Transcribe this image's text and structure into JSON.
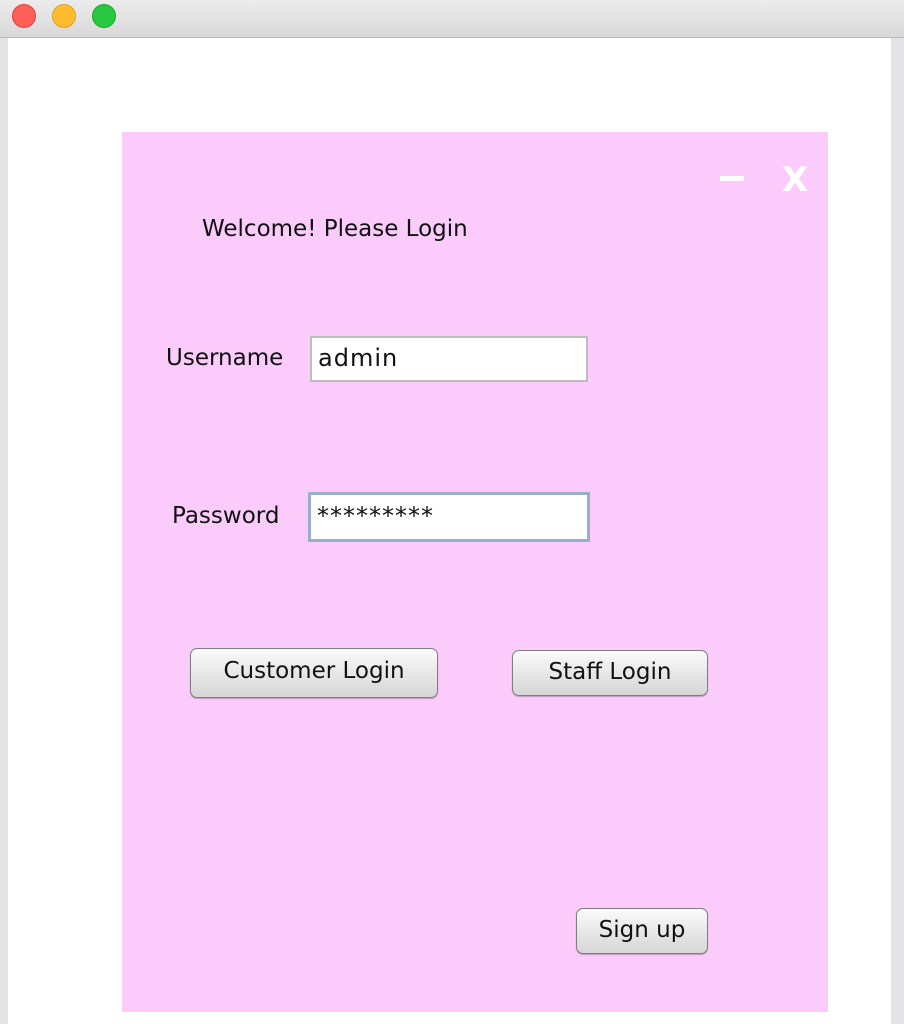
{
  "panel": {
    "minimize_glyph": "",
    "close_glyph": "X",
    "welcome_text": "Welcome! Please Login"
  },
  "form": {
    "username_label": "Username",
    "username_value": "admin",
    "password_label": "Password",
    "password_value": "*********"
  },
  "buttons": {
    "customer_login": "Customer Login",
    "staff_login": "Staff Login",
    "sign_up": "Sign up"
  },
  "colors": {
    "panel_background": "#fbccfb",
    "focus_border": "#98aecb"
  }
}
